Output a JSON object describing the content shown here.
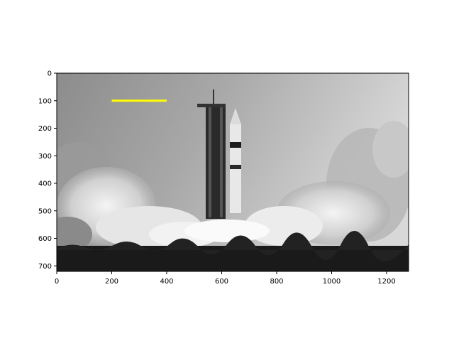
{
  "chart_data": {
    "type": "image",
    "title": "",
    "xlabel": "",
    "ylabel": "",
    "xlim": [
      0,
      1280
    ],
    "ylim": [
      720,
      0
    ],
    "y_inverted": true,
    "xticks": [
      0,
      200,
      400,
      600,
      800,
      1000,
      1200
    ],
    "yticks": [
      0,
      100,
      200,
      300,
      400,
      500,
      600,
      700
    ],
    "grid": false,
    "legend": "none",
    "image_content": "grayscale photo of a rocket launch with smoke clouds",
    "overlay_line": {
      "x": [
        200,
        400
      ],
      "y": [
        100,
        100
      ],
      "color": "#ffff00"
    }
  }
}
